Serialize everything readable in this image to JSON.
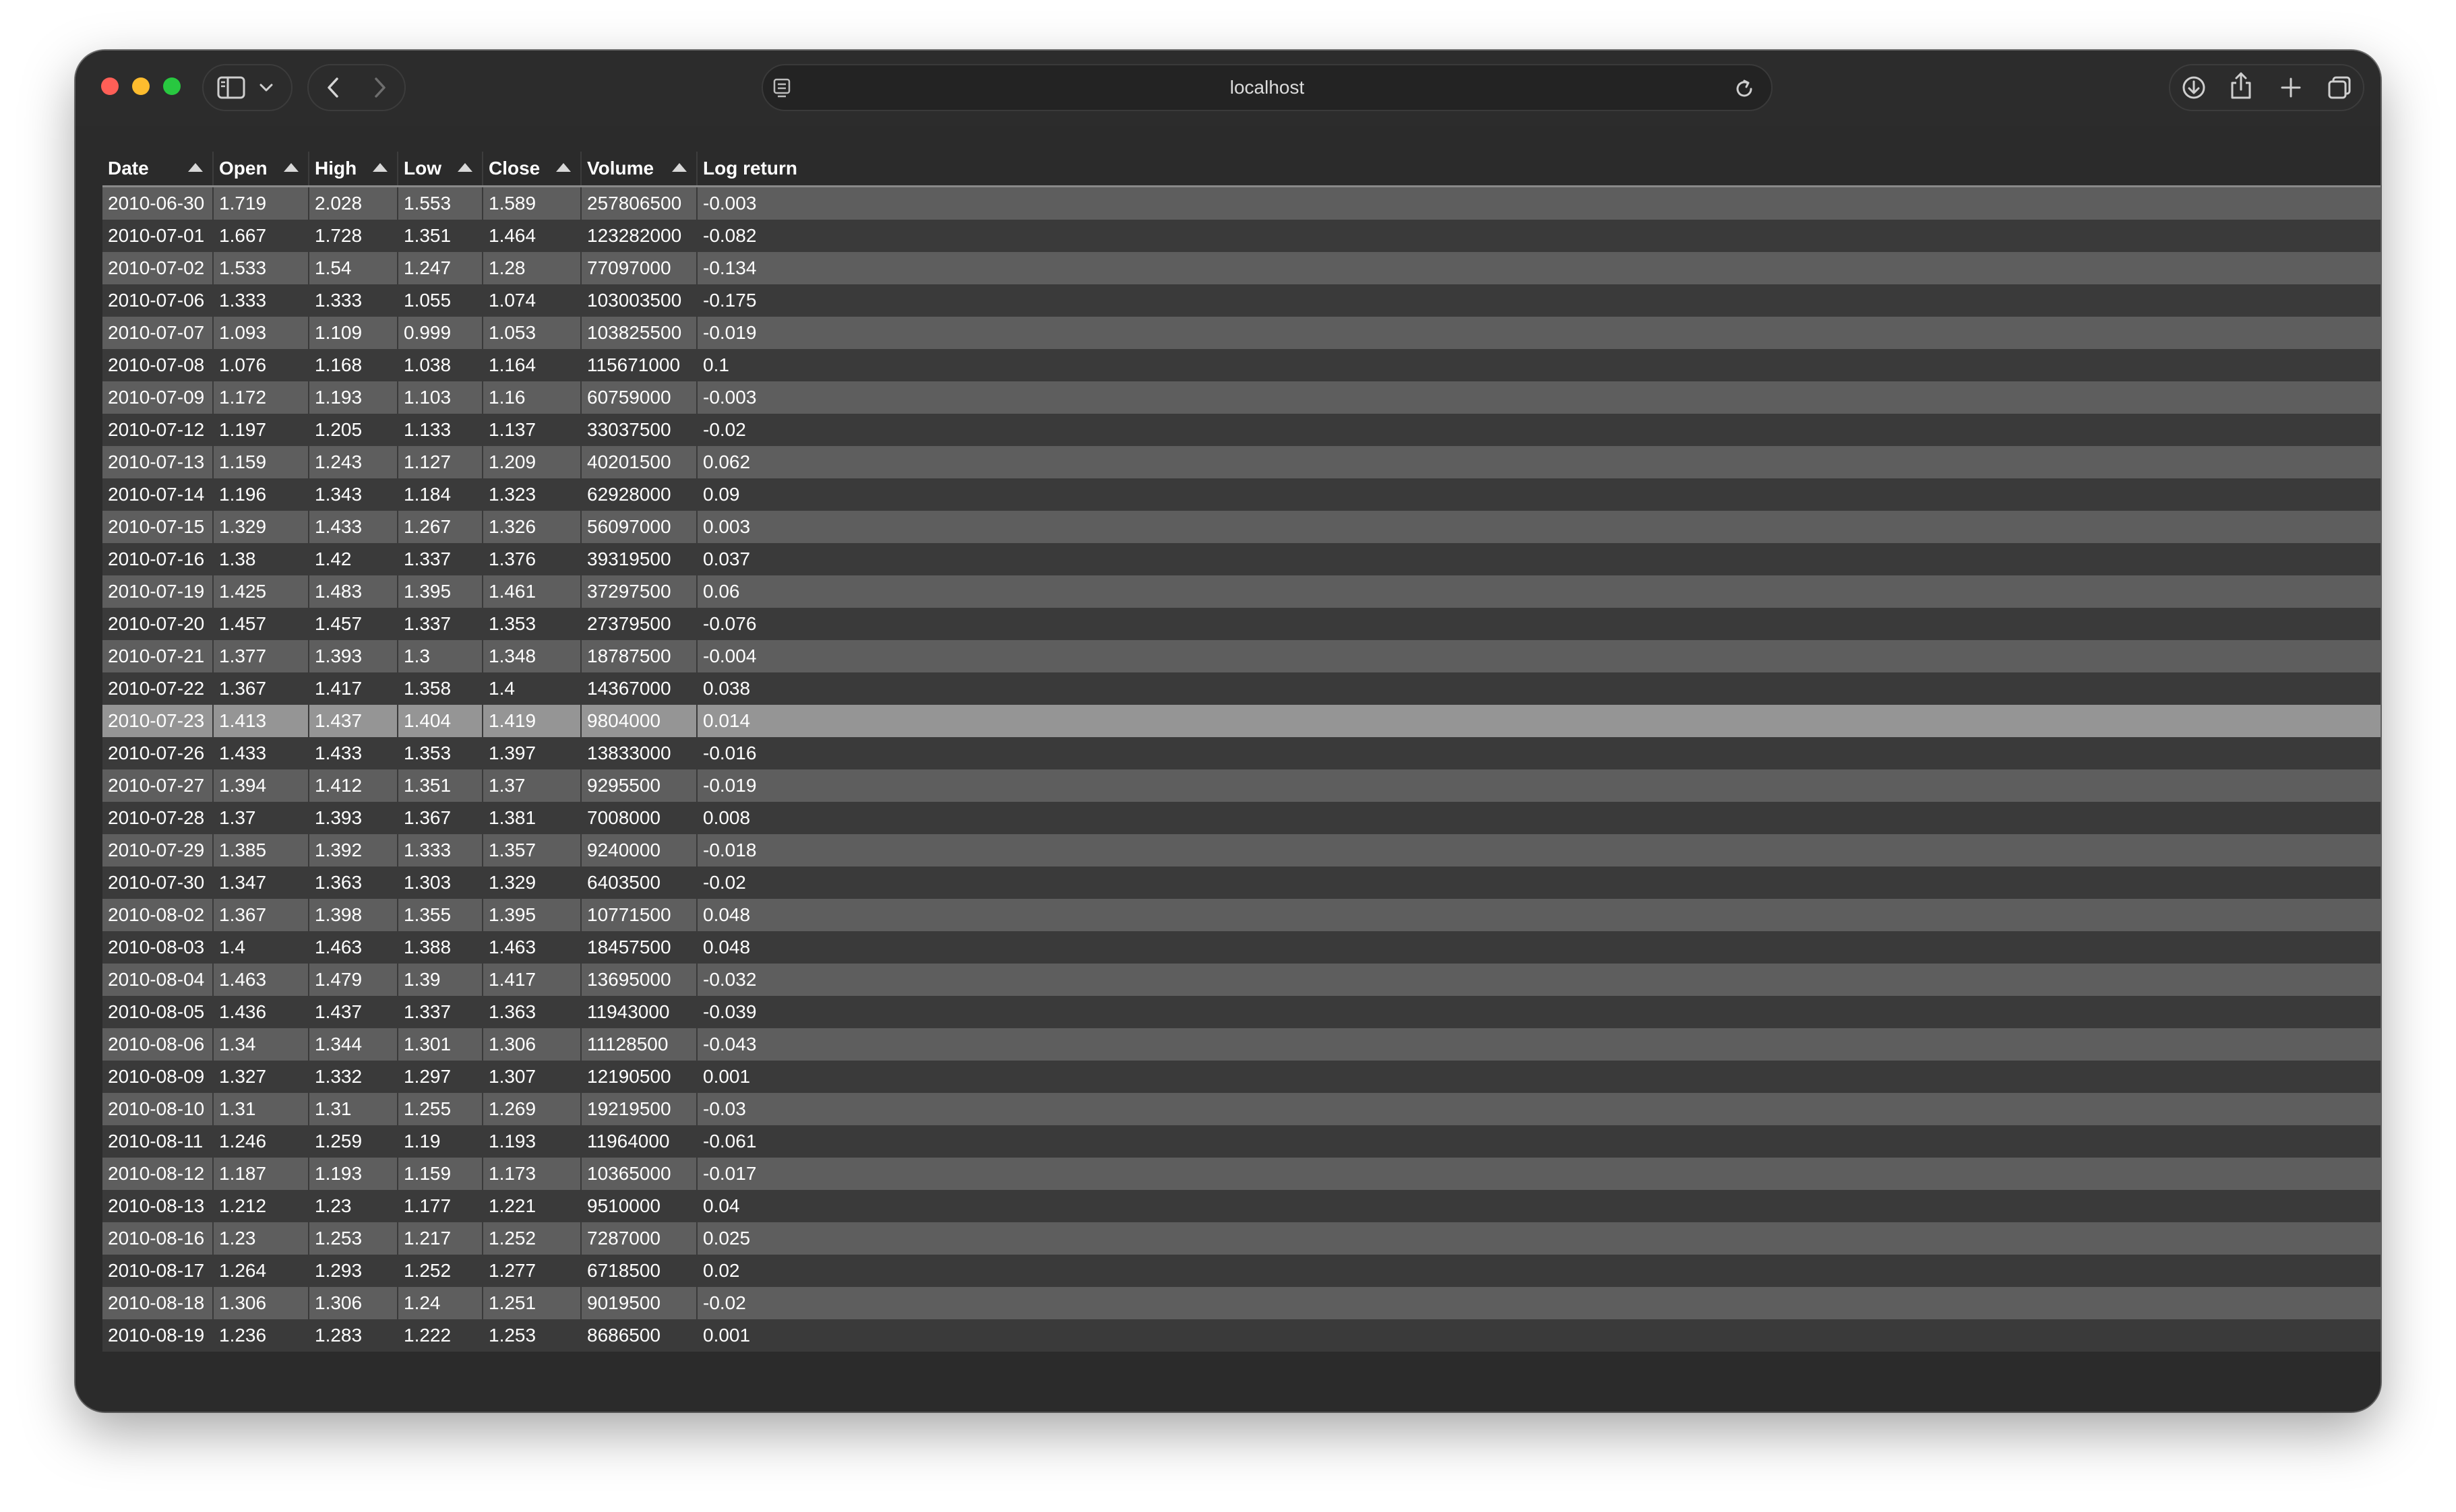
{
  "browser": {
    "url": "localhost",
    "icons": {
      "sidebar": "sidebar-icon",
      "chevron": "chevron-down-icon",
      "back": "back-icon",
      "forward": "forward-icon",
      "reader": "reader-icon",
      "reload": "reload-icon",
      "download": "download-icon",
      "share": "share-icon",
      "new_tab": "plus-icon",
      "tabs": "tabs-icon"
    }
  },
  "table": {
    "columns": [
      "Date",
      "Open",
      "High",
      "Low",
      "Close",
      "Volume",
      "Log return"
    ],
    "highlighted_row": 16,
    "rows": [
      [
        "2010-06-30",
        "1.719",
        "2.028",
        "1.553",
        "1.589",
        "257806500",
        "-0.003"
      ],
      [
        "2010-07-01",
        "1.667",
        "1.728",
        "1.351",
        "1.464",
        "123282000",
        "-0.082"
      ],
      [
        "2010-07-02",
        "1.533",
        "1.54",
        "1.247",
        "1.28",
        "77097000",
        "-0.134"
      ],
      [
        "2010-07-06",
        "1.333",
        "1.333",
        "1.055",
        "1.074",
        "103003500",
        "-0.175"
      ],
      [
        "2010-07-07",
        "1.093",
        "1.109",
        "0.999",
        "1.053",
        "103825500",
        "-0.019"
      ],
      [
        "2010-07-08",
        "1.076",
        "1.168",
        "1.038",
        "1.164",
        "115671000",
        "0.1"
      ],
      [
        "2010-07-09",
        "1.172",
        "1.193",
        "1.103",
        "1.16",
        "60759000",
        "-0.003"
      ],
      [
        "2010-07-12",
        "1.197",
        "1.205",
        "1.133",
        "1.137",
        "33037500",
        "-0.02"
      ],
      [
        "2010-07-13",
        "1.159",
        "1.243",
        "1.127",
        "1.209",
        "40201500",
        "0.062"
      ],
      [
        "2010-07-14",
        "1.196",
        "1.343",
        "1.184",
        "1.323",
        "62928000",
        "0.09"
      ],
      [
        "2010-07-15",
        "1.329",
        "1.433",
        "1.267",
        "1.326",
        "56097000",
        "0.003"
      ],
      [
        "2010-07-16",
        "1.38",
        "1.42",
        "1.337",
        "1.376",
        "39319500",
        "0.037"
      ],
      [
        "2010-07-19",
        "1.425",
        "1.483",
        "1.395",
        "1.461",
        "37297500",
        "0.06"
      ],
      [
        "2010-07-20",
        "1.457",
        "1.457",
        "1.337",
        "1.353",
        "27379500",
        "-0.076"
      ],
      [
        "2010-07-21",
        "1.377",
        "1.393",
        "1.3",
        "1.348",
        "18787500",
        "-0.004"
      ],
      [
        "2010-07-22",
        "1.367",
        "1.417",
        "1.358",
        "1.4",
        "14367000",
        "0.038"
      ],
      [
        "2010-07-23",
        "1.413",
        "1.437",
        "1.404",
        "1.419",
        "9804000",
        "0.014"
      ],
      [
        "2010-07-26",
        "1.433",
        "1.433",
        "1.353",
        "1.397",
        "13833000",
        "-0.016"
      ],
      [
        "2010-07-27",
        "1.394",
        "1.412",
        "1.351",
        "1.37",
        "9295500",
        "-0.019"
      ],
      [
        "2010-07-28",
        "1.37",
        "1.393",
        "1.367",
        "1.381",
        "7008000",
        "0.008"
      ],
      [
        "2010-07-29",
        "1.385",
        "1.392",
        "1.333",
        "1.357",
        "9240000",
        "-0.018"
      ],
      [
        "2010-07-30",
        "1.347",
        "1.363",
        "1.303",
        "1.329",
        "6403500",
        "-0.02"
      ],
      [
        "2010-08-02",
        "1.367",
        "1.398",
        "1.355",
        "1.395",
        "10771500",
        "0.048"
      ],
      [
        "2010-08-03",
        "1.4",
        "1.463",
        "1.388",
        "1.463",
        "18457500",
        "0.048"
      ],
      [
        "2010-08-04",
        "1.463",
        "1.479",
        "1.39",
        "1.417",
        "13695000",
        "-0.032"
      ],
      [
        "2010-08-05",
        "1.436",
        "1.437",
        "1.337",
        "1.363",
        "11943000",
        "-0.039"
      ],
      [
        "2010-08-06",
        "1.34",
        "1.344",
        "1.301",
        "1.306",
        "11128500",
        "-0.043"
      ],
      [
        "2010-08-09",
        "1.327",
        "1.332",
        "1.297",
        "1.307",
        "12190500",
        "0.001"
      ],
      [
        "2010-08-10",
        "1.31",
        "1.31",
        "1.255",
        "1.269",
        "19219500",
        "-0.03"
      ],
      [
        "2010-08-11",
        "1.246",
        "1.259",
        "1.19",
        "1.193",
        "11964000",
        "-0.061"
      ],
      [
        "2010-08-12",
        "1.187",
        "1.193",
        "1.159",
        "1.173",
        "10365000",
        "-0.017"
      ],
      [
        "2010-08-13",
        "1.212",
        "1.23",
        "1.177",
        "1.221",
        "9510000",
        "0.04"
      ],
      [
        "2010-08-16",
        "1.23",
        "1.253",
        "1.217",
        "1.252",
        "7287000",
        "0.025"
      ],
      [
        "2010-08-17",
        "1.264",
        "1.293",
        "1.252",
        "1.277",
        "6718500",
        "0.02"
      ],
      [
        "2010-08-18",
        "1.306",
        "1.306",
        "1.24",
        "1.251",
        "9019500",
        "-0.02"
      ],
      [
        "2010-08-19",
        "1.236",
        "1.283",
        "1.222",
        "1.253",
        "8686500",
        "0.001"
      ]
    ]
  }
}
